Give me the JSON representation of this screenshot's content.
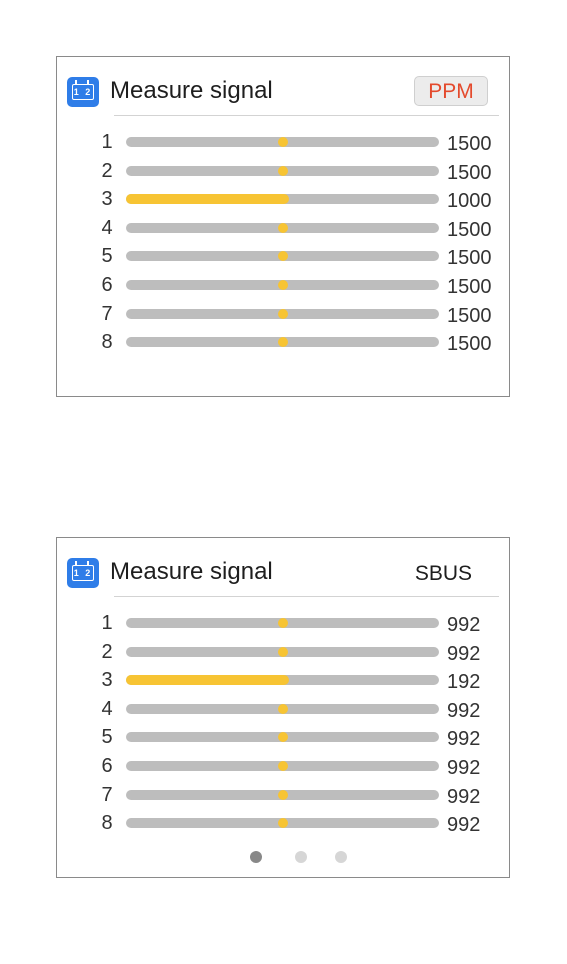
{
  "panels": [
    {
      "title": "Measure signal",
      "protocol": "PPM",
      "channels": [
        {
          "label": "1",
          "value": "1500",
          "fill": 0.5
        },
        {
          "label": "2",
          "value": "1500",
          "fill": 0.5
        },
        {
          "label": "3",
          "value": "1000",
          "fill": 0.0
        },
        {
          "label": "4",
          "value": "1500",
          "fill": 0.5
        },
        {
          "label": "5",
          "value": "1500",
          "fill": 0.5
        },
        {
          "label": "6",
          "value": "1500",
          "fill": 0.5
        },
        {
          "label": "7",
          "value": "1500",
          "fill": 0.5
        },
        {
          "label": "8",
          "value": "1500",
          "fill": 0.5
        }
      ]
    },
    {
      "title": "Measure signal",
      "protocol": "SBUS",
      "channels": [
        {
          "label": "1",
          "value": "992",
          "fill": 0.5
        },
        {
          "label": "2",
          "value": "992",
          "fill": 0.5
        },
        {
          "label": "3",
          "value": "192",
          "fill": 0.0
        },
        {
          "label": "4",
          "value": "992",
          "fill": 0.5
        },
        {
          "label": "5",
          "value": "992",
          "fill": 0.5
        },
        {
          "label": "6",
          "value": "992",
          "fill": 0.5
        },
        {
          "label": "7",
          "value": "992",
          "fill": 0.5
        },
        {
          "label": "8",
          "value": "992",
          "fill": 0.5
        }
      ],
      "pager": {
        "pages": 3,
        "active": 0
      }
    }
  ],
  "colors": {
    "accent": "#f7c433",
    "track": "#bdbdbd",
    "protocol_highlight": "#e44a2d",
    "icon_blue": "#2f7de8"
  },
  "icons": {
    "app": "calendar-channel-icon"
  }
}
